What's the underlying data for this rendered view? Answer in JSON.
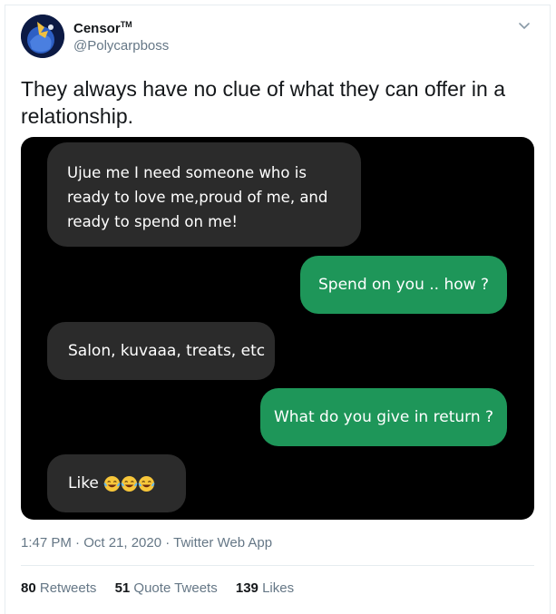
{
  "author": {
    "name": "Censor",
    "tm": "TM",
    "handle": "@Polycarpboss"
  },
  "tweet": {
    "text": "They always have no clue of what they can offer in a relationship."
  },
  "chat": {
    "messages": [
      {
        "side": "in",
        "text": "Ujue me I need someone who is ready to love me,proud of me, and ready to spend on me!"
      },
      {
        "side": "out",
        "text": "Spend on you .. how ?"
      },
      {
        "side": "in",
        "text": "Salon,  kuvaaa, treats, etc"
      },
      {
        "side": "out",
        "text": "What do you give in return ?"
      },
      {
        "side": "in",
        "text": "Like",
        "emoji": "face-with-tears-of-joy x3"
      }
    ],
    "colors": {
      "incoming": "#2b2b2b",
      "outgoing": "#1e9659",
      "background": "#000000"
    }
  },
  "meta": {
    "timestamp": "1:47 PM · Oct 21, 2020 · Twitter Web App"
  },
  "stats": {
    "retweets_count": "80",
    "retweets_label": "Retweets",
    "quotes_count": "51",
    "quotes_label": "Quote Tweets",
    "likes_count": "139",
    "likes_label": "Likes"
  },
  "icons": {
    "menu": "chevron-down-icon",
    "emoji": "laughing-emoji-icon"
  }
}
